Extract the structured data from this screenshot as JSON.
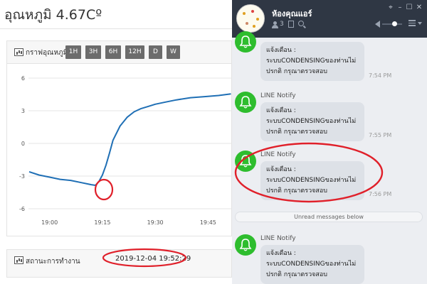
{
  "dashboard": {
    "title": "อุณหภูมิ 4.67Cº",
    "chart_panel": {
      "label": "กราฟอุณหภูมิ",
      "range_buttons": [
        "1H",
        "3H",
        "6H",
        "12H",
        "D",
        "W"
      ]
    },
    "status_panel": {
      "label": "สถานะการทำงาน",
      "timestamp": "2019-12-04 19:52:29"
    }
  },
  "chart_data": {
    "type": "line",
    "title": "",
    "xlabel": "",
    "ylabel": "",
    "x_ticks": [
      "19:00",
      "19:15",
      "19:30",
      "19:45"
    ],
    "y_ticks": [
      6,
      3,
      0,
      -3,
      -6
    ],
    "ylim": [
      -6,
      6
    ],
    "grid": true,
    "line_color": "#1f6fb5",
    "series": [
      {
        "x_minutes": [
          -5.8,
          -3,
          0,
          3,
          6,
          9,
          12,
          13,
          14,
          15,
          16,
          17,
          18,
          20,
          22,
          24,
          26,
          28,
          30,
          33,
          36,
          40,
          44,
          48,
          51.5
        ],
        "values": [
          -2.6,
          -2.9,
          -3.1,
          -3.3,
          -3.4,
          -3.6,
          -3.8,
          -3.85,
          -3.5,
          -2.9,
          -2.0,
          -0.9,
          0.3,
          1.6,
          2.4,
          2.9,
          3.2,
          3.4,
          3.6,
          3.8,
          4.0,
          4.2,
          4.3,
          4.4,
          4.55
        ]
      }
    ]
  },
  "chat": {
    "group_name": "ห้องคุณแอร์",
    "member_count": "3",
    "messages": [
      {
        "sender": "",
        "lines": [
          "แจ้งเตือน :",
          "ระบบCONDENSINGของท่านไม่",
          "ปรกติ กรุณาตรวจสอบ"
        ],
        "time": "7:54 PM"
      },
      {
        "sender": "LINE Notify",
        "lines": [
          "แจ้งเตือน :",
          "ระบบCONDENSINGของท่านไม่",
          "ปรกติ กรุณาตรวจสอบ"
        ],
        "time": "7:55 PM"
      },
      {
        "sender": "LINE Notify",
        "lines": [
          "แจ้งเตือน :",
          "ระบบCONDENSINGของท่านไม่",
          "ปรกติ กรุณาตรวจสอบ"
        ],
        "time": "7:56 PM"
      },
      {
        "sender": "LINE Notify",
        "lines": [
          "แจ้งเตือน :",
          "ระบบCONDENSINGของท่านไม่",
          "ปรกติ กรุณาตรวจสอบ"
        ],
        "time": ""
      }
    ],
    "unread_divider": "Unread messages below"
  },
  "colors": {
    "chat_header": "#2f3744",
    "line_green": "#2ebd2e",
    "highlight_red": "#e0202a",
    "range_button": "#6c6c6c"
  }
}
